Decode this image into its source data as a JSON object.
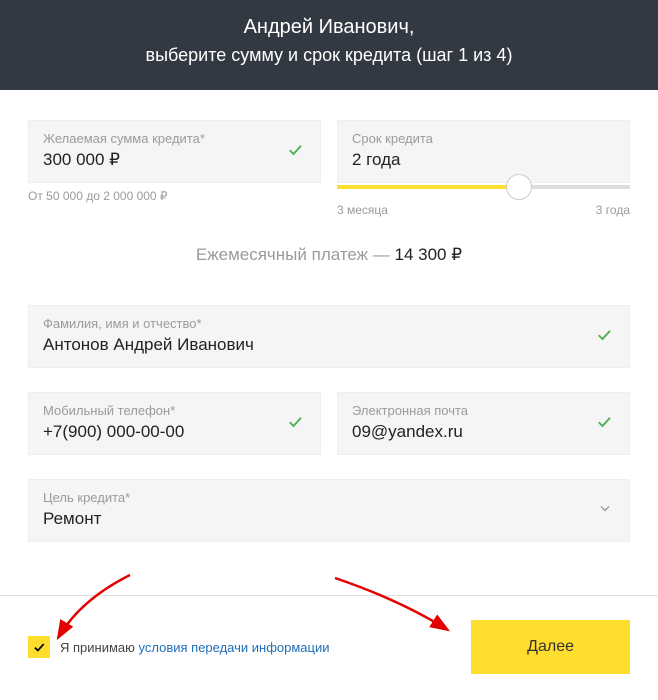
{
  "header": {
    "name": "Андрей Иванович,",
    "sub": "выберите сумму и срок кредита (шаг 1 из 4)"
  },
  "amount": {
    "label": "Желаемая сумма кредита",
    "value": "300 000 ₽",
    "hint": "От 50 000 до 2 000 000 ₽"
  },
  "term": {
    "label": "Срок кредита",
    "value": "2 года",
    "min": "3 месяца",
    "max": "3 года"
  },
  "payment": {
    "label": "Ежемесячный платеж — ",
    "value": "14 300 ₽"
  },
  "fullname": {
    "label": "Фамилия, имя и отчество",
    "value": "Антонов Андрей Иванович"
  },
  "phone": {
    "label": "Мобильный телефон",
    "value": "+7(900) 000-00-00"
  },
  "email": {
    "label": "Электронная почта",
    "value": "09@yandex.ru"
  },
  "purpose": {
    "label": "Цель кредита",
    "value": "Ремонт"
  },
  "consent": {
    "prefix": "Я принимаю ",
    "link": "условия передачи информации"
  },
  "next": "Далее"
}
